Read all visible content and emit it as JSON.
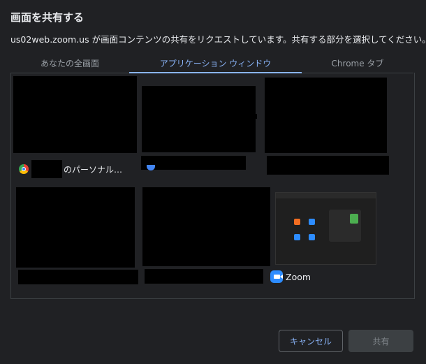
{
  "dialog": {
    "title": "画面を共有する",
    "subtitle": "us02web.zoom.us が画面コンテンツの共有をリクエストしています。共有する部分を選択してください。"
  },
  "tabs": [
    {
      "label": "あなたの全画面",
      "selected": false
    },
    {
      "label": "アプリケーション ウィンドウ",
      "selected": true
    },
    {
      "label": "Chrome タブ",
      "selected": false
    }
  ],
  "windows": [
    {
      "label": "のパーソナル…",
      "icon": "chrome-icon",
      "redacted": true
    },
    {
      "label": "",
      "icon": "chrome-icon",
      "redacted": true
    },
    {
      "label": "",
      "icon": "",
      "redacted": true
    },
    {
      "label": "",
      "icon": "",
      "redacted": true
    },
    {
      "label": "",
      "icon": "",
      "redacted": true
    },
    {
      "label": "Zoom",
      "icon": "zoom-icon",
      "redacted": false
    }
  ],
  "buttons": {
    "cancel": "キャンセル",
    "share": "共有"
  },
  "colors": {
    "background": "#202124",
    "accent": "#8ab4f8",
    "zoom": "#2d8cff"
  }
}
